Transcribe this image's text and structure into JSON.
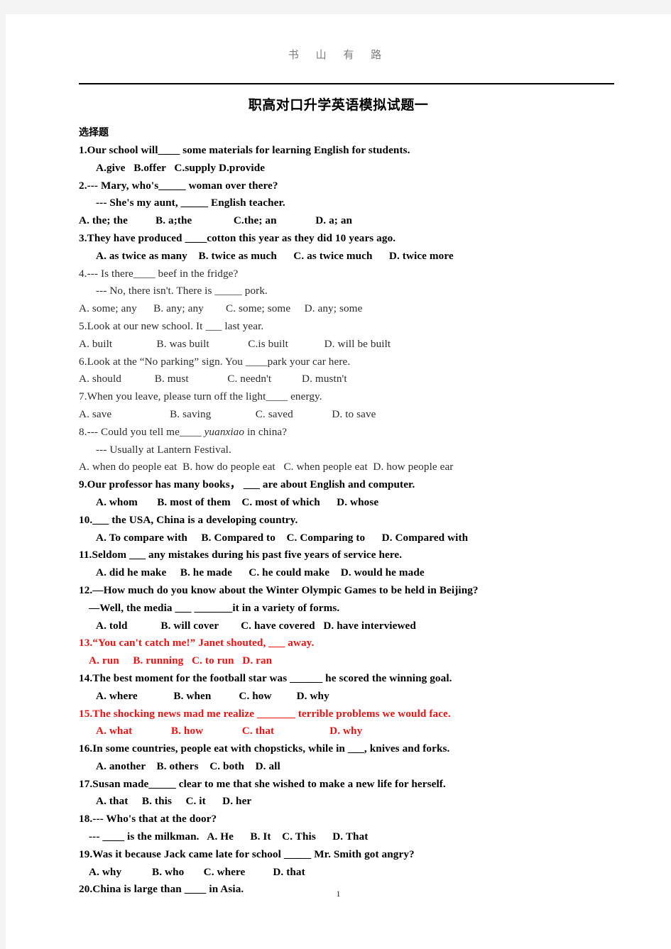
{
  "header": {
    "running_head": "书 山 有 路"
  },
  "title": "职高对口升学英语模拟试题一",
  "section_heading": "选择题",
  "footer": {
    "page_number": "1"
  },
  "colors": {
    "highlight_red": "#ee1111",
    "running_head_gray": "#7c7c7c",
    "page_background": "#ffffff",
    "canvas_background": "#f4f4f4"
  },
  "questions": [
    {
      "id": "q1",
      "lines": [
        {
          "text": "1.Our school will____ some materials for learning English for students.",
          "weight": "bold",
          "indent": 0
        },
        {
          "text": "A.give   B.offer   C.supply D.provide",
          "weight": "bold",
          "indent": 1
        }
      ]
    },
    {
      "id": "q2",
      "lines": [
        {
          "text": "2.--- Mary, who's_____ woman over there?",
          "weight": "bold",
          "indent": 0
        },
        {
          "text": "--- She's my aunt, _____ English teacher.",
          "weight": "bold",
          "indent": 1
        },
        {
          "text": "A. the; the          B. a;the               C.the; an              D. a; an",
          "weight": "bold",
          "indent": 0
        }
      ]
    },
    {
      "id": "q3",
      "lines": [
        {
          "text": "3.They have produced ____cotton this year as they did 10 years ago.",
          "weight": "bold",
          "indent": 0
        },
        {
          "text": "A. as twice as many    B. twice as much      C. as twice much      D. twice more",
          "weight": "bold",
          "indent": 1
        }
      ]
    },
    {
      "id": "q4",
      "lines": [
        {
          "text": "4.--- Is there____ beef in the fridge?",
          "weight": "light",
          "indent": 0
        },
        {
          "text": "--- No, there isn't. There is _____ pork.",
          "weight": "light",
          "indent": 1
        },
        {
          "text": "A. some; any      B. any; any        C. some; some     D. any; some",
          "weight": "light",
          "indent": 0
        }
      ]
    },
    {
      "id": "q5",
      "lines": [
        {
          "text": "5.Look at our new school. It ___ last year.",
          "weight": "light",
          "indent": 0
        },
        {
          "text": "A. built                B. was built              C.is built             D. will be built",
          "weight": "light",
          "indent": 0
        }
      ]
    },
    {
      "id": "q6",
      "lines": [
        {
          "text": "6.Look at the “No parking” sign. You ____park your car here.",
          "weight": "light",
          "indent": 0
        },
        {
          "text": "A. should            B. must              C. needn't           D. mustn't",
          "weight": "light",
          "indent": 0
        }
      ]
    },
    {
      "id": "q7",
      "lines": [
        {
          "text": "7.When you leave, please turn off the light____ energy.",
          "weight": "light",
          "indent": 0
        },
        {
          "text": "A. save                     B. saving                C. saved              D. to save",
          "weight": "light",
          "indent": 0
        }
      ]
    },
    {
      "id": "q8",
      "lines": [
        {
          "text": "8.--- Could you tell me____ yuanxiao in china?",
          "weight": "light",
          "indent": 0,
          "italic_word": "yuanxiao"
        },
        {
          "text": "--- Usually at Lantern Festival.",
          "weight": "light",
          "indent": 1
        },
        {
          "text": "A. when do people eat  B. how do people eat   C. when people eat  D. how people ear",
          "weight": "light",
          "indent": 0
        }
      ]
    },
    {
      "id": "q9",
      "lines": [
        {
          "text": "9.Our professor has many books， ___ are about English and computer.",
          "weight": "bold",
          "indent": 0
        },
        {
          "text": "A. whom       B. most of them    C. most of which      D. whose",
          "weight": "bold",
          "indent": 1
        }
      ]
    },
    {
      "id": "q10",
      "lines": [
        {
          "text": "10.___ the USA, China is a developing country.",
          "weight": "bold",
          "indent": 0
        },
        {
          "text": "A. To compare with     B. Compared to    C. Comparing to      D. Compared with",
          "weight": "bold",
          "indent": 1
        }
      ]
    },
    {
      "id": "q11",
      "lines": [
        {
          "text": "11.Seldom ___ any mistakes during his past five years of service here.",
          "weight": "bold",
          "indent": 0
        },
        {
          "text": "A. did he make     B. he made      C. he could make    D. would he made",
          "weight": "bold",
          "indent": 1
        }
      ]
    },
    {
      "id": "q12",
      "lines": [
        {
          "text": "12.—How much do you know about the Winter Olympic Games to be held in Beijing?",
          "weight": "bold",
          "indent": 0
        },
        {
          "text": "—Well, the media ___ _______it in a variety of forms.",
          "weight": "bold",
          "indent": 2
        },
        {
          "text": "A. told            B. will cover        C. have covered   D. have interviewed",
          "weight": "bold",
          "indent": 1
        }
      ]
    },
    {
      "id": "q13",
      "lines": [
        {
          "text": "13.“You can't catch me!” Janet shouted, ___ away.",
          "weight": "red",
          "indent": 0
        },
        {
          "text": "A. run     B. running   C. to run   D. ran",
          "weight": "red",
          "indent": 2
        }
      ]
    },
    {
      "id": "q14",
      "lines": [
        {
          "text": "14.The best moment for the football star was ______ he scored the winning goal.",
          "weight": "bold",
          "indent": 0
        },
        {
          "text": "A. where             B. when          C. how         D. why",
          "weight": "bold",
          "indent": 1
        }
      ]
    },
    {
      "id": "q15",
      "lines": [
        {
          "text": "15.The shocking news mad me realize _______ terrible problems we would face.",
          "weight": "red",
          "indent": 0
        },
        {
          "text": "A. what              B. how              C. that                    D. why",
          "weight": "red",
          "indent": 1
        }
      ]
    },
    {
      "id": "q16",
      "lines": [
        {
          "text": "16.In some countries, people eat with chopsticks, while in ___, knives and forks.",
          "weight": "bold",
          "indent": 0
        },
        {
          "text": "A. another    B. others    C. both    D. all",
          "weight": "bold",
          "indent": 1
        }
      ]
    },
    {
      "id": "q17",
      "lines": [
        {
          "text": "17.Susan made_____ clear to me that she wished to make a new life for herself.",
          "weight": "bold",
          "indent": 0
        },
        {
          "text": "A. that     B. this     C. it      D. her",
          "weight": "bold",
          "indent": 1
        }
      ]
    },
    {
      "id": "q18",
      "lines": [
        {
          "text": "18.--- Who's that at the door?",
          "weight": "bold",
          "indent": 0
        },
        {
          "text": "--- ____ is the milkman.   A. He      B. It    C. This      D. That",
          "weight": "bold",
          "indent": 2
        }
      ]
    },
    {
      "id": "q19",
      "lines": [
        {
          "text": "19.Was it because Jack came late for school _____ Mr. Smith got angry?",
          "weight": "bold",
          "indent": 0
        },
        {
          "text": "A. why           B. who       C. where          D. that",
          "weight": "bold",
          "indent": 2
        }
      ]
    },
    {
      "id": "q20",
      "lines": [
        {
          "text": "20.China is large than ____ in Asia.",
          "weight": "bold",
          "indent": 0
        }
      ]
    }
  ]
}
